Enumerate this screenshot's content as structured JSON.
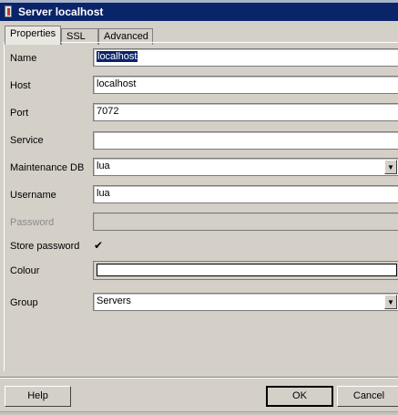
{
  "window": {
    "title": "Server localhost"
  },
  "tabs": [
    {
      "label": "Properties",
      "active": true
    },
    {
      "label": "SSL",
      "active": false
    },
    {
      "label": "Advanced",
      "active": false
    }
  ],
  "form": {
    "name": {
      "label": "Name",
      "value": "localhost"
    },
    "host": {
      "label": "Host",
      "value": "localhost"
    },
    "port": {
      "label": "Port",
      "value": "7072"
    },
    "service": {
      "label": "Service",
      "value": ""
    },
    "maintenance_db": {
      "label": "Maintenance DB",
      "value": "lua"
    },
    "username": {
      "label": "Username",
      "value": "lua"
    },
    "password": {
      "label": "Password",
      "value": "",
      "disabled": true
    },
    "store_password": {
      "label": "Store password",
      "checked": true,
      "glyph": "✔"
    },
    "colour": {
      "label": "Colour",
      "value": "#ffffff"
    },
    "group": {
      "label": "Group",
      "value": "Servers"
    }
  },
  "buttons": {
    "help": "Help",
    "ok": "OK",
    "cancel": "Cancel"
  },
  "icons": {
    "dropdown": "▼"
  }
}
